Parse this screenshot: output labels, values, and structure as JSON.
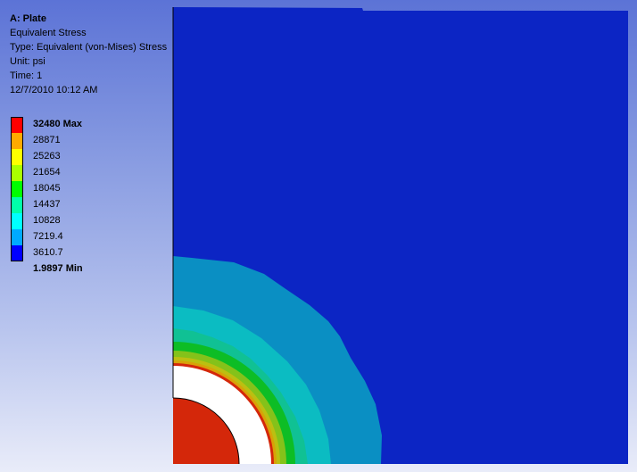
{
  "info": {
    "title": "A: Plate",
    "result_name": "Equivalent Stress",
    "type": "Type: Equivalent (von-Mises) Stress",
    "unit": "Unit: psi",
    "time": "Time: 1",
    "timestamp": "12/7/2010 10:12 AM"
  },
  "legend": {
    "max_label": "32480 Max",
    "min_label": "1.9897 Min",
    "values": [
      "28871",
      "25263",
      "21654",
      "18045",
      "14437",
      "10828",
      "7219.4",
      "3610.7"
    ],
    "colors": [
      "#ff0000",
      "#ffaa00",
      "#ffff00",
      "#aaff00",
      "#00ff00",
      "#00ffaa",
      "#00ffff",
      "#00aaff",
      "#0000ff"
    ]
  },
  "plot_colors": {
    "background_region": "#0c25c4",
    "band_1": "#0a8fc3",
    "band_2": "#0bbcc2",
    "band_3": "#10c194",
    "band_4": "#0dbd25",
    "band_5": "#84c21a",
    "band_6": "#bcbf11",
    "band_7": "#d8a208",
    "band_8": "#d4270a",
    "outline": "#000000"
  }
}
